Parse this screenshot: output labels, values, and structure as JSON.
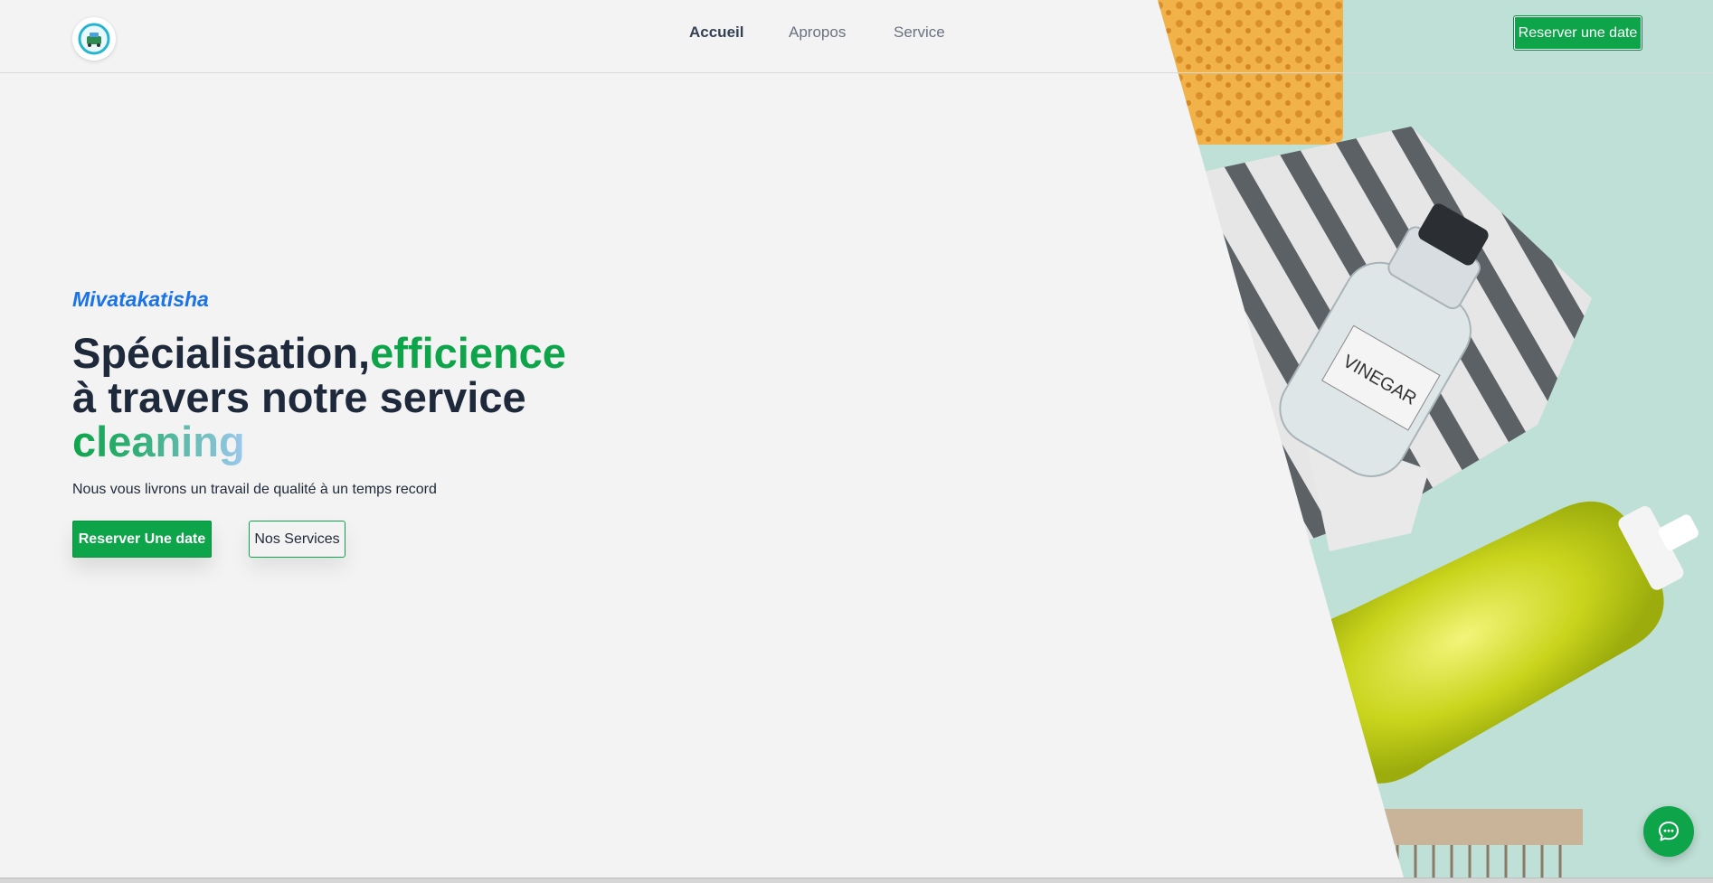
{
  "header": {
    "logo_icon": "cleaning-logo-icon",
    "nav": [
      {
        "label": "Accueil",
        "active": true
      },
      {
        "label": "Apropos",
        "active": false
      },
      {
        "label": "Service",
        "active": false
      }
    ],
    "cta_label": "Reserver une date"
  },
  "hero": {
    "brand": "Mivatakatisha",
    "headline": {
      "part1": "Spécialisation,",
      "part2_green": "efficience",
      "part3": "à travers notre service",
      "part4_gradient": "cleaning"
    },
    "subtext": "Nous vous livrons un travail de qualité à un temps record",
    "primary_button": "Reserver Une date",
    "secondary_button": "Nos Services",
    "image_label": "VINEGAR"
  },
  "chat": {
    "icon": "chat-bubble-icon"
  },
  "colors": {
    "accent_green": "#0ea44a",
    "brand_blue": "#1a73e8",
    "panel_mint": "#bfe0d6"
  }
}
